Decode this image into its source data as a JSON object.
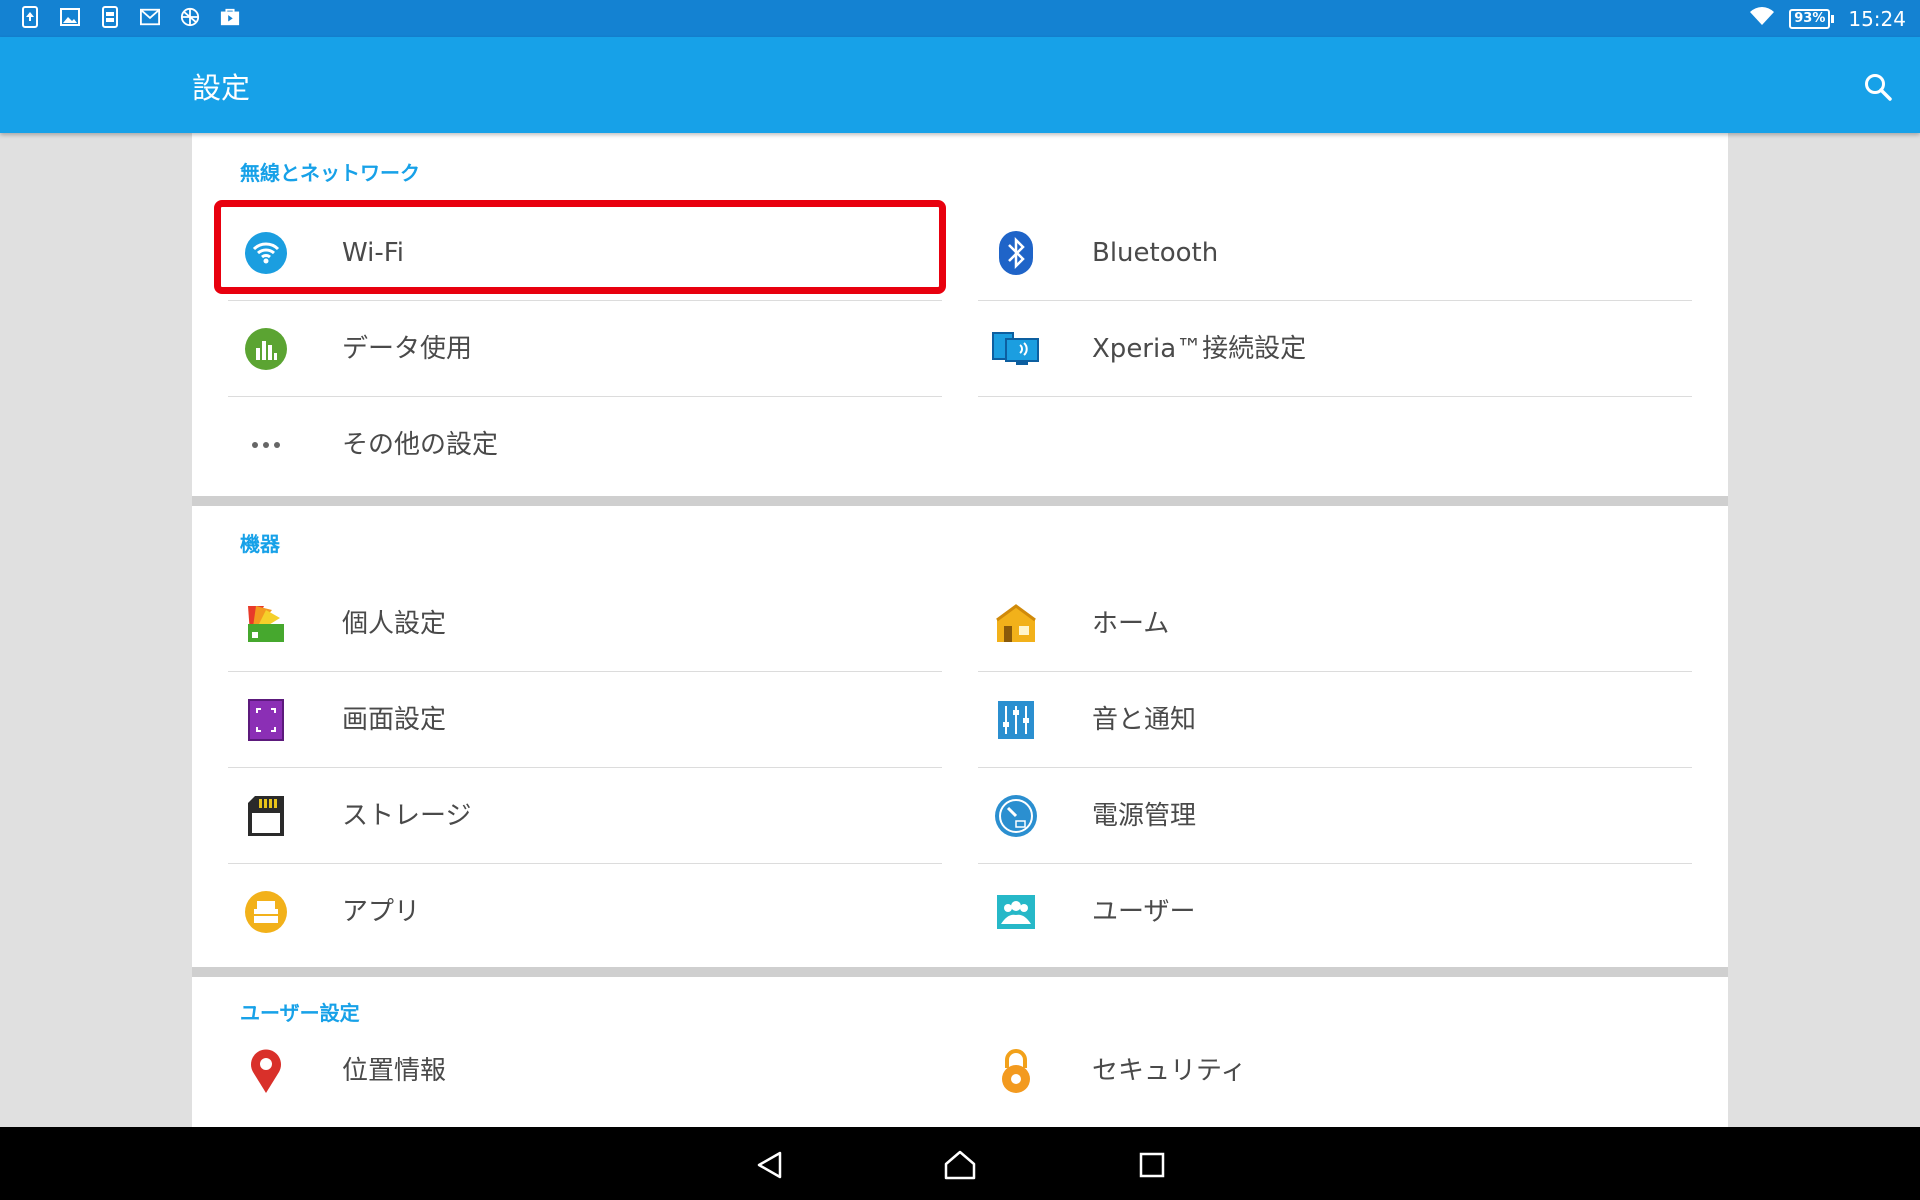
{
  "status_bar": {
    "notification_icons": [
      "upload-icon",
      "image-icon",
      "phone-transfer-icon",
      "gmail-icon",
      "globe-icon",
      "store-icon"
    ],
    "wifi_icon": "wifi-icon",
    "battery": "93%",
    "time": "15:24"
  },
  "app_bar": {
    "title": "設定",
    "search_icon": "search-icon"
  },
  "sections": [
    {
      "header": "無線とネットワーク",
      "items": [
        {
          "label": "Wi-Fi",
          "icon": "wifi-icon"
        },
        {
          "label": "Bluetooth",
          "icon": "bluetooth-icon"
        },
        {
          "label": "データ使用",
          "icon": "data-usage-icon"
        },
        {
          "label": "Xperia™接続設定",
          "icon": "xperia-connect-icon"
        },
        {
          "label": "その他の設定",
          "icon": "more-icon"
        }
      ]
    },
    {
      "header": "機器",
      "items": [
        {
          "label": "個人設定",
          "icon": "personalization-icon"
        },
        {
          "label": "ホーム",
          "icon": "home-icon"
        },
        {
          "label": "画面設定",
          "icon": "display-icon"
        },
        {
          "label": "音と通知",
          "icon": "sound-icon"
        },
        {
          "label": "ストレージ",
          "icon": "storage-icon"
        },
        {
          "label": "電源管理",
          "icon": "power-icon"
        },
        {
          "label": "アプリ",
          "icon": "apps-icon"
        },
        {
          "label": "ユーザー",
          "icon": "users-icon"
        }
      ]
    },
    {
      "header": "ユーザー設定",
      "items": [
        {
          "label": "位置情報",
          "icon": "location-icon"
        },
        {
          "label": "セキュリティ",
          "icon": "security-icon"
        }
      ]
    }
  ],
  "nav_bar": {
    "back": "back-icon",
    "home": "home-nav-icon",
    "recents": "recents-icon"
  },
  "colors": {
    "status_bar": "#1482d2",
    "app_bar": "#17a1e8",
    "accent": "#17a1e8",
    "highlight": "#e8000e"
  }
}
